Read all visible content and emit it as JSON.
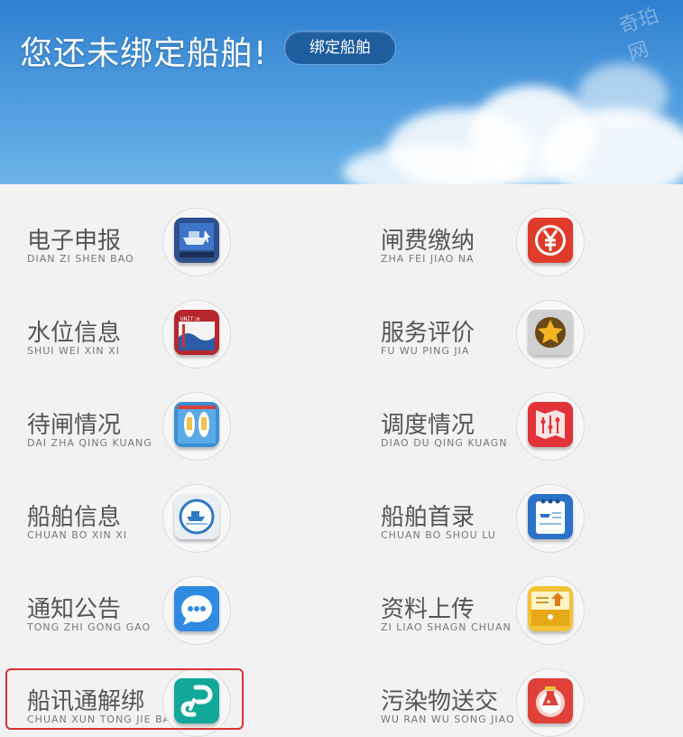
{
  "banner": {
    "title": "您还未绑定船舶!",
    "bind_button": "绑定船舶",
    "watermark": "奇珀网"
  },
  "items": [
    {
      "cn": "电子申报",
      "py": "DIAN ZI SHEN BAO",
      "icon": "ship-report-icon"
    },
    {
      "cn": "闸费缴纳",
      "py": "ZHA FEI JIAO NA",
      "icon": "yuan-icon"
    },
    {
      "cn": "水位信息",
      "py": "SHUI WEI XIN XI",
      "icon": "water-level-icon"
    },
    {
      "cn": "服务评价",
      "py": "FU WU PING JIA",
      "icon": "star-icon"
    },
    {
      "cn": "待闸情况",
      "py": "DAI ZHA QING KUANG",
      "icon": "lock-wait-icon"
    },
    {
      "cn": "调度情况",
      "py": "DIAO DU QING KUAGN",
      "icon": "dispatch-icon"
    },
    {
      "cn": "船舶信息",
      "py": "CHUAN BO XIN XI",
      "icon": "ship-info-icon"
    },
    {
      "cn": "船舶首录",
      "py": "CHUAN BO SHOU LU",
      "icon": "ship-record-icon"
    },
    {
      "cn": "通知公告",
      "py": "TONG ZHI GONG GAO",
      "icon": "chat-icon"
    },
    {
      "cn": "资料上传",
      "py": "ZI LIAO SHAGN CHUAN",
      "icon": "upload-icon"
    },
    {
      "cn": "船讯通解绑",
      "py": "CHUAN XUN TONG JIE BANG",
      "icon": "unbind-icon"
    },
    {
      "cn": "污染物送交",
      "py": "WU RAN WU SONG JIAO",
      "icon": "pollutant-icon"
    }
  ],
  "colors": {
    "banner_top": "#2f7fcf",
    "button": "#1e5d9e",
    "highlight": "#d93434",
    "text": "#555555",
    "subtext": "#777777"
  }
}
